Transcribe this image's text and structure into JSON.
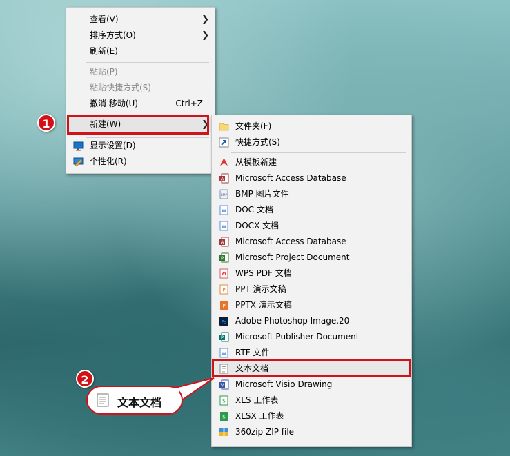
{
  "context_menu": {
    "items": [
      {
        "label": "查看(V)"
      },
      {
        "label": "排序方式(O)"
      },
      {
        "label": "刷新(E)"
      },
      {
        "label": "粘贴(P)"
      },
      {
        "label": "粘贴快捷方式(S)"
      },
      {
        "label": "撤消 移动(U)",
        "shortcut": "Ctrl+Z"
      },
      {
        "label": "新建(W)"
      },
      {
        "label": "显示设置(D)"
      },
      {
        "label": "个性化(R)"
      }
    ]
  },
  "submenu": {
    "items": [
      {
        "label": "文件夹(F)",
        "icon": "folder-icon"
      },
      {
        "label": "快捷方式(S)",
        "icon": "shortcut-icon"
      },
      {
        "label": "从模板新建",
        "icon": "template-icon"
      },
      {
        "label": "Microsoft Access Database",
        "icon": "access-icon"
      },
      {
        "label": "BMP 图片文件",
        "icon": "bmp-icon"
      },
      {
        "label": "DOC 文档",
        "icon": "doc-icon"
      },
      {
        "label": "DOCX 文档",
        "icon": "docx-icon"
      },
      {
        "label": "Microsoft Access Database",
        "icon": "access-icon"
      },
      {
        "label": "Microsoft Project Document",
        "icon": "project-icon"
      },
      {
        "label": "WPS PDF 文档",
        "icon": "pdf-icon"
      },
      {
        "label": "PPT 演示文稿",
        "icon": "ppt-icon"
      },
      {
        "label": "PPTX 演示文稿",
        "icon": "pptx-icon"
      },
      {
        "label": "Adobe Photoshop Image.20",
        "icon": "photoshop-icon"
      },
      {
        "label": "Microsoft Publisher Document",
        "icon": "publisher-icon"
      },
      {
        "label": "RTF 文件",
        "icon": "rtf-icon"
      },
      {
        "label": "文本文档",
        "icon": "text-document-icon"
      },
      {
        "label": "Microsoft Visio Drawing",
        "icon": "visio-icon"
      },
      {
        "label": "XLS 工作表",
        "icon": "xls-icon"
      },
      {
        "label": "XLSX 工作表",
        "icon": "xlsx-icon"
      },
      {
        "label": "360zip ZIP file",
        "icon": "zip-icon"
      }
    ]
  },
  "annotations": {
    "step1": "1",
    "step2": "2",
    "callout_text": "文本文档"
  },
  "colors": {
    "highlight": "#d0121b",
    "menu_background": "#f2f2f2"
  }
}
